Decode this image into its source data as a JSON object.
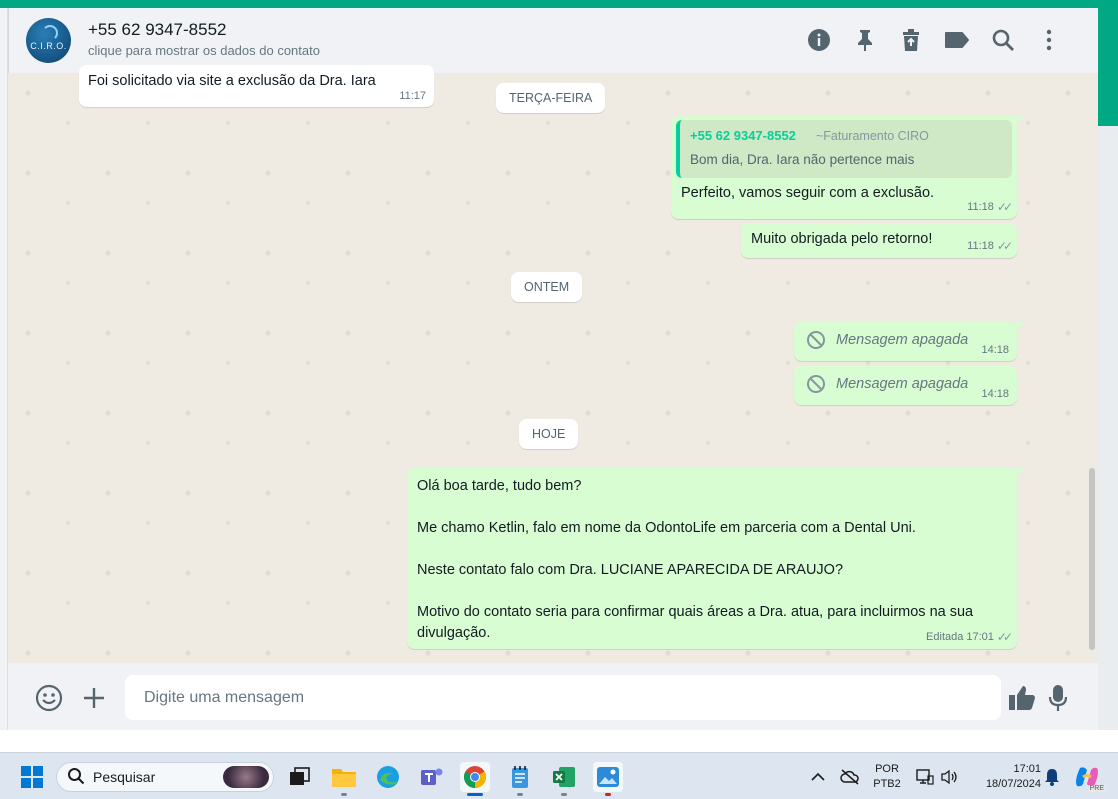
{
  "header": {
    "avatar_text": "C.I.R.O.",
    "contact_name": "+55 62 9347-8552",
    "contact_subtitle": "clique para mostrar os dados do contato",
    "icons": [
      "info-icon",
      "pin-icon",
      "delete-icon",
      "label-icon",
      "search-icon",
      "more-icon"
    ]
  },
  "messages": {
    "m0": {
      "text": "Foi solicitado via site a exclusão da Dra. Iara",
      "time": "11:17"
    },
    "date1": "TERÇA-FEIRA",
    "m1": {
      "quote_author": "+55 62 9347-8552",
      "quote_tag": "~Faturamento CIRO",
      "quote_text": "Bom dia, Dra. Iara não pertence mais",
      "text": "Perfeito, vamos seguir com a exclusão.",
      "time": "11:18"
    },
    "m2": {
      "text": "Muito obrigada pelo retorno!",
      "time": "11:18"
    },
    "date2": "ONTEM",
    "m3": {
      "text": "Mensagem apagada",
      "time": "14:18"
    },
    "m4": {
      "text": "Mensagem apagada",
      "time": "14:18"
    },
    "date3": "HOJE",
    "m5": {
      "line1": "Olá boa tarde, tudo bem?",
      "line2": "Me chamo Ketlin, falo em nome da OdontoLife em parceria com a Dental Uni.",
      "line3": "Neste contato falo com Dra. LUCIANE APARECIDA DE ARAUJO?",
      "line4a": "Motivo do contato seria para confirmar quais áreas a Dra. atua, para incluirmos na sua",
      "line4b": "divulgação.",
      "edited": "Editada",
      "time": "17:01"
    }
  },
  "composer": {
    "placeholder": "Digite uma mensagem",
    "icons": [
      "emoji-icon",
      "plus-icon",
      "thumbs-up-icon",
      "mic-icon"
    ]
  },
  "taskbar": {
    "search_placeholder": "Pesquisar",
    "apps": [
      "windows-start-icon",
      "task-view-icon",
      "file-explorer-icon",
      "edge-icon",
      "teams-icon",
      "chrome-icon",
      "notepad-icon",
      "excel-icon",
      "photos-icon"
    ],
    "lang_line1": "POR",
    "lang_line2": "PTB2",
    "time": "17:01",
    "date": "18/07/2024",
    "copilot_badge": "PRE"
  },
  "colors": {
    "accent": "#00a884",
    "outgoing_bubble": "#d9fdd3",
    "chat_bg": "#efeae2"
  }
}
